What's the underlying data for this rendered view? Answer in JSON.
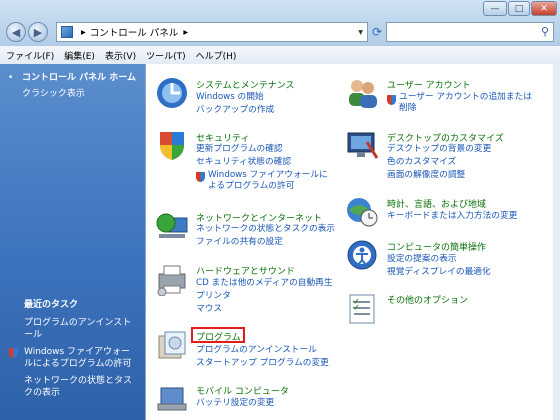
{
  "address": {
    "crumbs": [
      "コントロール パネル"
    ]
  },
  "menu": [
    "ファイル(F)",
    "編集(E)",
    "表示(V)",
    "ツール(T)",
    "ヘルプ(H)"
  ],
  "sidebar": {
    "home": "コントロール パネル ホーム",
    "classic": "クラシック表示",
    "recent_header": "最近のタスク",
    "recent": [
      "プログラムのアンインストール",
      "Windows ファイアウォールによるプログラムの許可",
      "ネットワークの状態とタスクの表示"
    ]
  },
  "categories": {
    "system": {
      "title": "システムとメンテナンス",
      "links": [
        "Windows の開始",
        "バックアップの作成"
      ]
    },
    "security": {
      "title": "セキュリティ",
      "links": [
        "更新プログラムの確認",
        "セキュリティ状態の確認",
        "Windows ファイアウォールによるプログラムの許可"
      ]
    },
    "network": {
      "title": "ネットワークとインターネット",
      "links": [
        "ネットワークの状態とタスクの表示",
        "ファイルの共有の設定"
      ]
    },
    "hardware": {
      "title": "ハードウェアとサウンド",
      "links": [
        "CD または他のメディアの自動再生",
        "プリンタ",
        "マウス"
      ]
    },
    "programs": {
      "title": "プログラム",
      "links": [
        "プログラムのアンインストール",
        "スタートアップ プログラムの変更"
      ]
    },
    "mobile": {
      "title": "モバイル コンピュータ",
      "links": [
        "バッテリ設定の変更"
      ]
    },
    "user": {
      "title": "ユーザー アカウント",
      "links": [
        "ユーザー アカウントの追加または削除"
      ]
    },
    "desktop": {
      "title": "デスクトップのカスタマイズ",
      "links": [
        "デスクトップの背景の変更",
        "色のカスタマイズ",
        "画面の解像度の調整"
      ]
    },
    "clock": {
      "title": "時計、言語、および地域",
      "links": [
        "キーボードまたは入力方法の変更"
      ]
    },
    "ease": {
      "title": "コンピュータの簡単操作",
      "links": [
        "設定の提案の表示",
        "視覚ディスプレイの最適化"
      ]
    },
    "other": {
      "title": "その他のオプション"
    }
  },
  "icons": {
    "back": "back-arrow-icon",
    "forward": "forward-arrow-icon",
    "refresh": "refresh-icon",
    "search": "search-icon",
    "shield": "uac-shield-icon"
  },
  "colors": {
    "sidebar": "#3d73bd",
    "link": "#1a56b4",
    "category": "#0a6e0a",
    "highlight": "#e21b1b"
  }
}
